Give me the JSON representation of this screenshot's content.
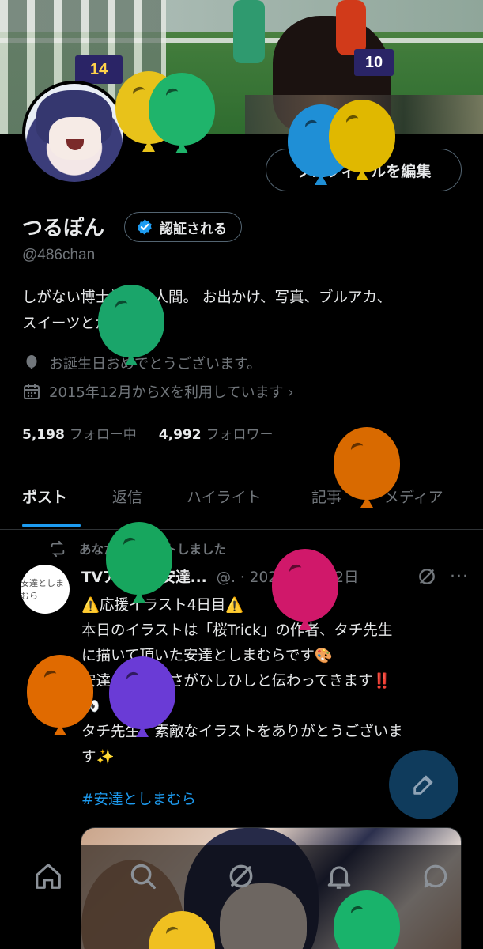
{
  "profile": {
    "edit_button": "プロフィールを編集",
    "display_name": "つるぽん",
    "verify_label": "認証される",
    "handle": "@486chan",
    "bio_line1": "しがない博士課程の人間。 お出かけ、写真、ブルアカ、",
    "bio_line2": "スイーツとかが好き！",
    "birthday": "お誕生日おめでとうございます。",
    "joined": "2015年12月からXを利用しています ›",
    "following_count": "5,198",
    "following_label": "フォロー中",
    "followers_count": "4,992",
    "followers_label": "フォロワー"
  },
  "banner": {
    "num_left": "14",
    "num_right": "10"
  },
  "tabs": [
    {
      "label": "ポスト"
    },
    {
      "label": "返信"
    },
    {
      "label": "ハイライト"
    },
    {
      "label": "記事"
    },
    {
      "label": "メディア"
    }
  ],
  "post": {
    "repost_text": "あなたがリポストしました",
    "avatar_text": "安達としまむら",
    "author": "TVアニメ『安達...",
    "meta": "@. · 2020年10月2日",
    "more": "···",
    "body": "⚠️応援イラスト4日目⚠️\n本日のイラストは「桜Trick」の作者、タチ先生\nに描いて頂いた安達としまむらです🎨\n安達の精一杯さがひしひしと伝わってきます‼️\n👀\nタチ先生、素敵なイラストをありがとうございま\nす✨",
    "hashtag": "#安達としまむら"
  },
  "colors": {
    "accent": "#1d9bf0",
    "muted": "#71767b",
    "text": "#e7e9ea",
    "background": "#000000",
    "balloons": [
      "#e8c21a",
      "#1fb46b",
      "#1f8fd6",
      "#e0a800",
      "#1aa56a",
      "#d96a00",
      "#17a65e",
      "#d0186a",
      "#e06a00",
      "#6a3bd6",
      "#19b36b",
      "#f0c020"
    ]
  },
  "icons": {
    "bottom_nav": [
      "home-icon",
      "search-icon",
      "grok-icon",
      "bell-icon",
      "messages-icon"
    ],
    "fab": "compose-icon"
  }
}
